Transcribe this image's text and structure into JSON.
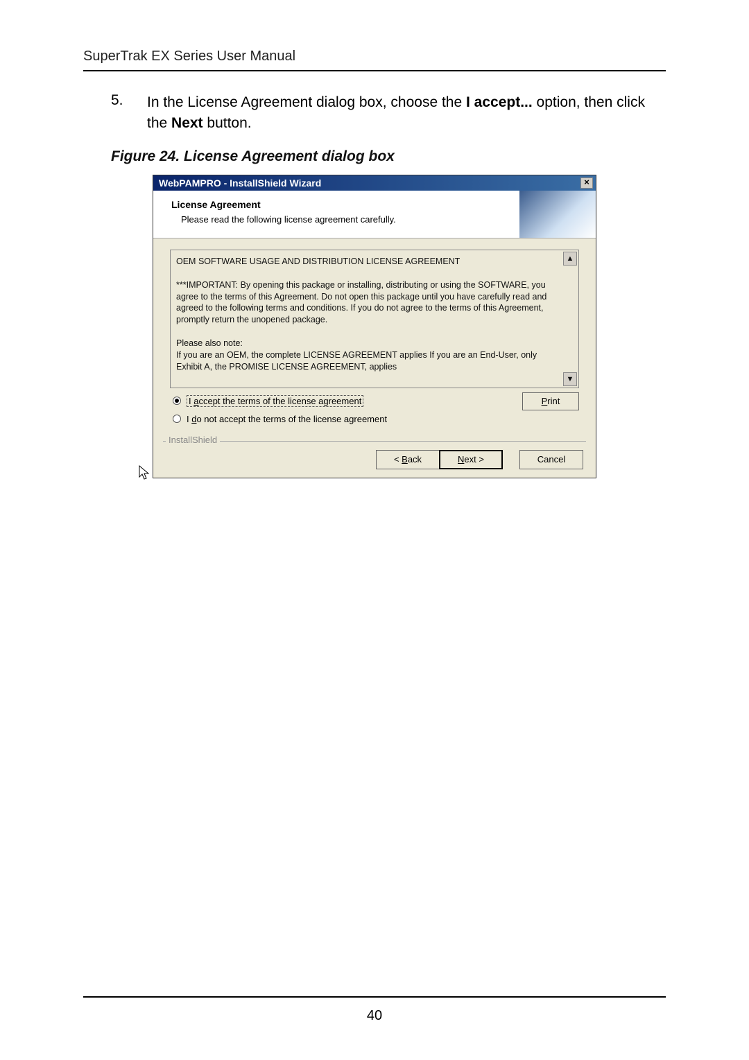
{
  "header": "SuperTrak EX Series User Manual",
  "step": {
    "num": "5.",
    "text_before": "In the License Agreement dialog box, choose the ",
    "bold1": "I accept...",
    "text_mid": " option, then click the ",
    "bold2": "Next",
    "text_after": " button."
  },
  "figure_caption": "Figure 24. License Agreement dialog box",
  "dialog": {
    "title": "WebPAMPRO - InstallShield Wizard",
    "close": "×",
    "head_title": "License Agreement",
    "head_sub": "Please read the following license agreement carefully.",
    "license_p1": "OEM SOFTWARE USAGE AND DISTRIBUTION LICENSE AGREEMENT",
    "license_p2": "***IMPORTANT: By opening this package or installing, distributing or using the SOFTWARE, you agree to the terms of this Agreement.  Do not open this package until you have carefully read and agreed to the following terms and conditions.  If you do not agree to the terms of this Agreement, promptly return the unopened package.",
    "license_p3": "Please also note:",
    "license_p4": "If you are an OEM, the complete LICENSE AGREEMENT applies If you are an End-User, only Exhibit A, the PROMISE LICENSE AGREEMENT, applies",
    "scroll_up": "▲",
    "scroll_down": "▼",
    "radio_accept_pre": "I ",
    "radio_accept_u": "a",
    "radio_accept_post": "ccept the terms of the license agreement",
    "radio_reject_pre": "I ",
    "radio_reject_u": "d",
    "radio_reject_post": "o not accept the terms of the license agreement",
    "print_u": "P",
    "print_post": "rint",
    "footer_brand": "InstallShield",
    "back_pre": "< ",
    "back_u": "B",
    "back_post": "ack",
    "next_u": "N",
    "next_post": "ext >",
    "cancel": "Cancel"
  },
  "page_number": "40"
}
